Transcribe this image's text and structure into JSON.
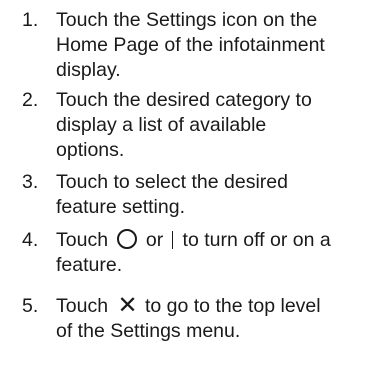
{
  "steps": [
    {
      "number": "1.",
      "lines": [
        "Touch the Settings icon on the",
        "Home Page of the infotainment",
        "display."
      ]
    },
    {
      "number": "2.",
      "lines": [
        "Touch the desired category to",
        "display a list of available",
        "options."
      ]
    },
    {
      "number": "3.",
      "lines": [
        "Touch to select the desired",
        "feature setting."
      ]
    },
    {
      "number": "4.",
      "line1_before": "Touch",
      "line1_middle": "or",
      "line1_after": "to turn off or on a",
      "line2": "feature.",
      "icons": [
        "circle-off-icon",
        "bar-on-icon"
      ]
    },
    {
      "number": "5.",
      "line1_before": "Touch",
      "line1_after": "to go to the top level",
      "line2": "of the Settings menu.",
      "icons": [
        "close-x-icon"
      ]
    }
  ]
}
